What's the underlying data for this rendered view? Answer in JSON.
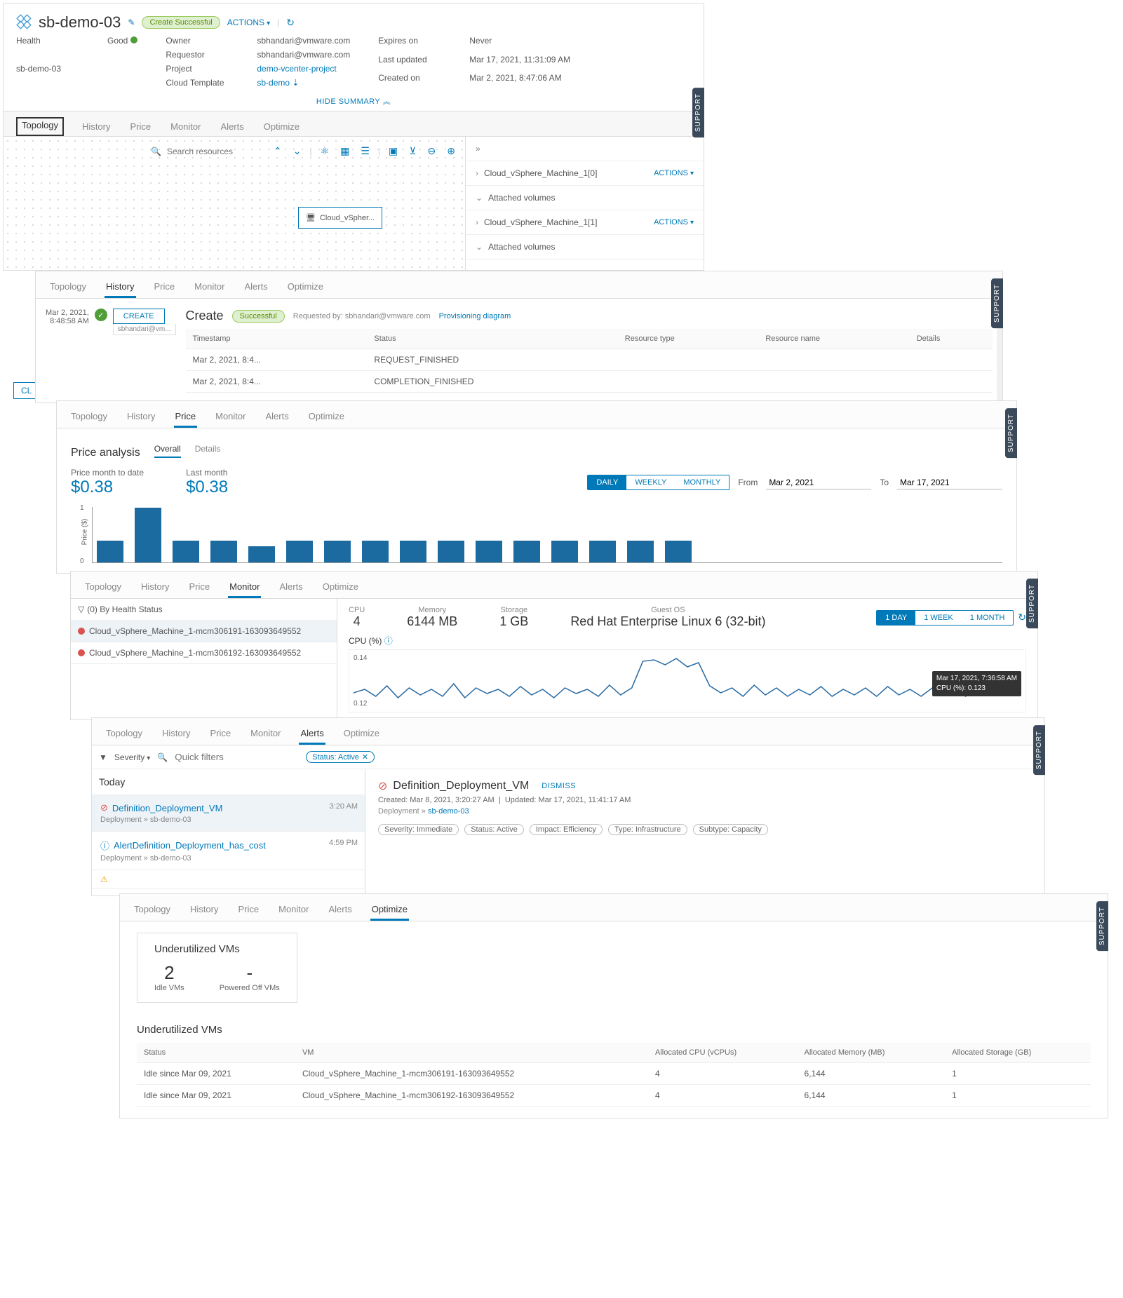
{
  "header": {
    "title": "sb-demo-03",
    "status_pill": "Create Successful",
    "actions_label": "ACTIONS",
    "hide_summary": "HIDE SUMMARY"
  },
  "meta_left": {
    "health_label": "Health",
    "health_value": "Good",
    "name_label": "sb-demo-03"
  },
  "meta_mid": {
    "owner_label": "Owner",
    "owner_value": "sbhandari@vmware.com",
    "requestor_label": "Requestor",
    "requestor_value": "sbhandari@vmware.com",
    "project_label": "Project",
    "project_value": "demo-vcenter-project",
    "template_label": "Cloud Template",
    "template_value": "sb-demo"
  },
  "meta_right": {
    "expires_label": "Expires on",
    "expires_value": "Never",
    "updated_label": "Last updated",
    "updated_value": "Mar 17, 2021, 11:31:09 AM",
    "created_label": "Created on",
    "created_value": "Mar 2, 2021, 8:47:06 AM"
  },
  "tabs": {
    "topology": "Topology",
    "history": "History",
    "price": "Price",
    "monitor": "Monitor",
    "alerts": "Alerts",
    "optimize": "Optimize"
  },
  "topology": {
    "search_placeholder": "Search resources",
    "node_label": "Cloud_vSpher...",
    "side": [
      {
        "chev": "›",
        "label": "Cloud_vSphere_Machine_1[0]",
        "actions": "ACTIONS"
      },
      {
        "chev": "⌄",
        "label": "Attached volumes"
      },
      {
        "chev": "›",
        "label": "Cloud_vSphere_Machine_1[1]",
        "actions": "ACTIONS"
      },
      {
        "chev": "⌄",
        "label": "Attached volumes"
      }
    ],
    "close": "CL"
  },
  "history": {
    "left_date": "Mar 2, 2021,",
    "left_time": "8:48:58 AM",
    "create_btn": "CREATE",
    "create_sub": "sbhandari@vm...",
    "title": "Create",
    "status_pill": "Successful",
    "req_by": "Requested by: sbhandari@vmware.com",
    "prov_link": "Provisioning diagram",
    "cols": {
      "ts": "Timestamp",
      "st": "Status",
      "rt": "Resource type",
      "rn": "Resource name",
      "d": "Details"
    },
    "rows": [
      {
        "ts": "Mar 2, 2021, 8:4...",
        "st": "REQUEST_FINISHED"
      },
      {
        "ts": "Mar 2, 2021, 8:4...",
        "st": "COMPLETION_FINISHED"
      }
    ]
  },
  "price": {
    "analysis": "Price analysis",
    "overall": "Overall",
    "details": "Details",
    "mtd_label": "Price month to date",
    "mtd_value": "$0.38",
    "last_label": "Last month",
    "last_value": "$0.38",
    "daily": "DAILY",
    "weekly": "WEEKLY",
    "monthly": "MONTHLY",
    "from_label": "From",
    "from_value": "Mar 2, 2021",
    "to_label": "To",
    "to_value": "Mar 17, 2021",
    "y0": "0",
    "y1": "1",
    "ylabel": "Price ($)"
  },
  "chart_data": {
    "type": "bar",
    "title": "Price analysis",
    "ylabel": "Price ($)",
    "ylim": [
      0,
      1
    ],
    "values": [
      0.4,
      1.0,
      0.4,
      0.4,
      0.3,
      0.4,
      0.4,
      0.4,
      0.4,
      0.4,
      0.4,
      0.4,
      0.4,
      0.4,
      0.4,
      0.4
    ]
  },
  "monitor": {
    "filter": "(0) By Health Status",
    "items": [
      "Cloud_vSphere_Machine_1-mcm306191-163093649552",
      "Cloud_vSphere_Machine_1-mcm306192-163093649552"
    ],
    "cpu_l": "CPU",
    "cpu_v": "4",
    "mem_l": "Memory",
    "mem_v": "6144 MB",
    "sto_l": "Storage",
    "sto_v": "1 GB",
    "os_l": "Guest OS",
    "os_v": "Red Hat Enterprise Linux 6 (32-bit)",
    "t1": "1 DAY",
    "t2": "1 WEEK",
    "t3": "1 MONTH",
    "cpu_title": "CPU (%)",
    "tick1": "0.14",
    "tick2": "0.12",
    "tip_time": "Mar 17, 2021, 7:36:58 AM",
    "tip_val": "CPU (%): 0.123"
  },
  "alerts": {
    "severity": "Severity",
    "quick": "Quick filters",
    "status_chip": "Status: Active",
    "today": "Today",
    "items": [
      {
        "icon": "warn",
        "title": "Definition_Deployment_VM",
        "bc": "Deployment » sb-demo-03",
        "time": "3:20 AM"
      },
      {
        "icon": "info",
        "title": "AlertDefinition_Deployment_has_cost",
        "bc": "Deployment » sb-demo-03",
        "time": "4:59 PM"
      }
    ],
    "detail_title": "Definition_Deployment_VM",
    "dismiss": "DISMISS",
    "created": "Created: Mar 8, 2021, 3:20:27 AM",
    "updated": "Updated: Mar 17, 2021, 11:41:17 AM",
    "bc": "Deployment » ",
    "bc_link": "sb-demo-03",
    "chips": [
      "Severity: Immediate",
      "Status: Active",
      "Impact: Efficiency",
      "Type: Infrastructure",
      "Subtype: Capacity"
    ]
  },
  "optimize": {
    "card_title": "Underutilized VMs",
    "idle_n": "2",
    "idle_l": "Idle VMs",
    "off_n": "-",
    "off_l": "Powered Off VMs",
    "tbl_title": "Underutilized VMs",
    "cols": {
      "status": "Status",
      "vm": "VM",
      "cpu": "Allocated CPU (vCPUs)",
      "mem": "Allocated Memory (MB)",
      "sto": "Allocated Storage (GB)"
    },
    "rows": [
      {
        "status": "Idle since Mar 09, 2021",
        "vm": "Cloud_vSphere_Machine_1-mcm306191-163093649552",
        "cpu": "4",
        "mem": "6,144",
        "sto": "1"
      },
      {
        "status": "Idle since Mar 09, 2021",
        "vm": "Cloud_vSphere_Machine_1-mcm306192-163093649552",
        "cpu": "4",
        "mem": "6,144",
        "sto": "1"
      }
    ]
  },
  "support": "SUPPORT"
}
